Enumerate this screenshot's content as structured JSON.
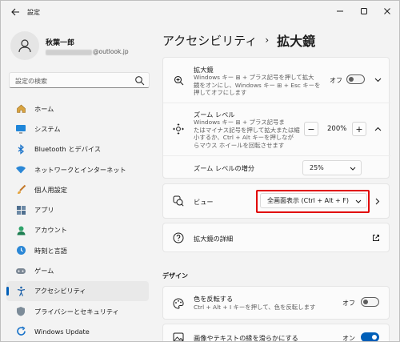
{
  "window": {
    "app_title": "設定"
  },
  "user": {
    "name": "秋葉一郎",
    "email_suffix": "@outlook.jp"
  },
  "search": {
    "placeholder": "設定の検索"
  },
  "nav": {
    "items": [
      {
        "label": "ホーム",
        "icon": "home-icon"
      },
      {
        "label": "システム",
        "icon": "system-icon"
      },
      {
        "label": "Bluetooth とデバイス",
        "icon": "bluetooth-icon"
      },
      {
        "label": "ネットワークとインターネット",
        "icon": "network-icon"
      },
      {
        "label": "個人用設定",
        "icon": "brush-icon"
      },
      {
        "label": "アプリ",
        "icon": "apps-icon"
      },
      {
        "label": "アカウント",
        "icon": "account-icon"
      },
      {
        "label": "時刻と言語",
        "icon": "time-language-icon"
      },
      {
        "label": "ゲーム",
        "icon": "gaming-icon"
      },
      {
        "label": "アクセシビリティ",
        "icon": "accessibility-icon"
      },
      {
        "label": "プライバシーとセキュリティ",
        "icon": "shield-icon"
      },
      {
        "label": "Windows Update",
        "icon": "update-icon"
      }
    ],
    "selected_index": 9
  },
  "breadcrumb": {
    "parent": "アクセシビリティ",
    "separator": "›",
    "current": "拡大鏡"
  },
  "magnifier": {
    "title": "拡大鏡",
    "desc_line1": "Windows キー ⊞ + プラス記号を押して拡大",
    "desc_line2": "鏡をオンにし、Windows キー ⊞ + Esc キーを",
    "desc_line3": "押してオフにします",
    "toggle_label": "オフ",
    "toggle_on": false
  },
  "zoom": {
    "title": "ズーム レベル",
    "desc_line1": "Windows キー ⊞ + プラス記号ま",
    "desc_line2": "たはマイナス記号を押して拡大または縮",
    "desc_line3": "小するか、Ctrl + Alt キーを押しなが",
    "desc_line4": "らマウス ホイールを回転させます",
    "minus": "−",
    "value": "200%",
    "plus": "+",
    "increment_label": "ズーム レベルの増分",
    "increment_value": "25%"
  },
  "view": {
    "label": "ビュー",
    "selected": "全画面表示 (Ctrl + Alt + F)"
  },
  "details": {
    "label": "拡大鏡の詳細"
  },
  "design": {
    "section_label": "デザイン",
    "invert_title": "色を反転する",
    "invert_desc": "Ctrl + Alt + I キーを押して、色を反転します",
    "invert_toggle_label": "オフ",
    "invert_on": false,
    "smooth_title": "画像やテキストの縁を滑らかにする",
    "smooth_toggle_label": "オン",
    "smooth_on": true
  },
  "colors": {
    "accent": "#005fb8",
    "highlight": "#e10000"
  }
}
